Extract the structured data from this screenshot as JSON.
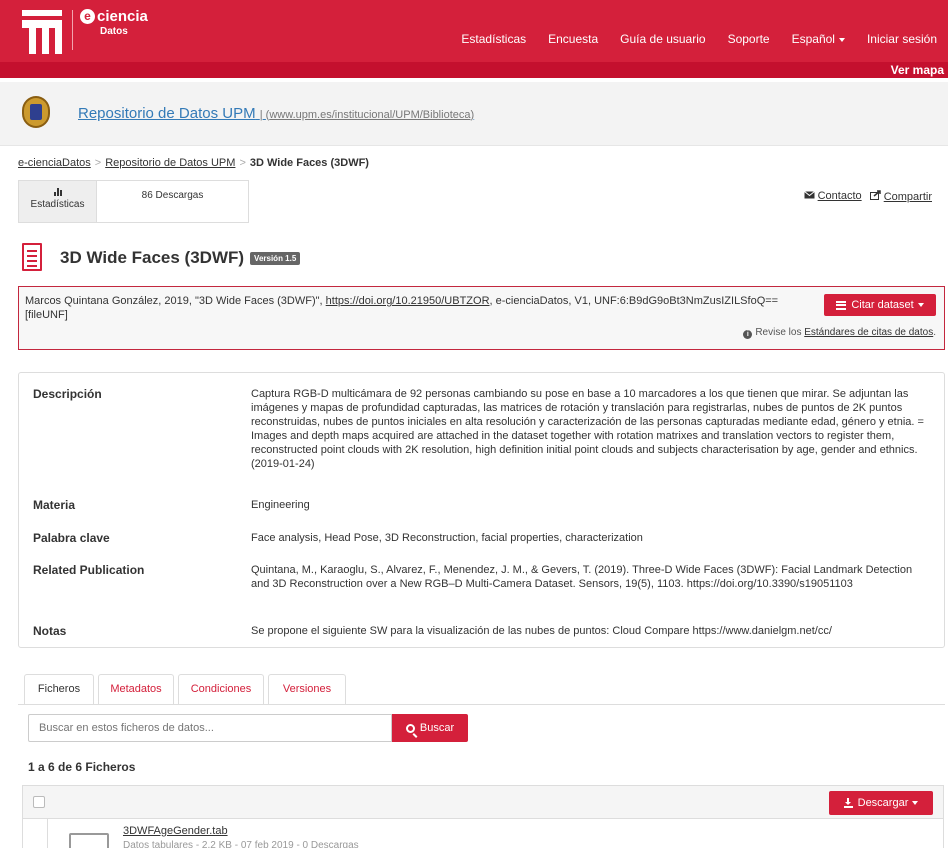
{
  "navbar": {
    "brand_name": "ciencia",
    "brand_e": "e",
    "brand_sub": "Datos",
    "links": [
      "Estadísticas",
      "Encuesta",
      "Guía de usuario",
      "Soporte"
    ],
    "language": "Español",
    "login": "Iniciar sesión",
    "ver_mapa": "Ver mapa"
  },
  "dataverse": {
    "title": "Repositorio de Datos UPM",
    "separator": "|",
    "url_open": "(",
    "url": "www.upm.es/institucional/UPM/Biblioteca",
    "url_close": ")"
  },
  "breadcrumb": {
    "items": [
      "e-cienciaDatos",
      "Repositorio de Datos UPM"
    ],
    "sep": ">",
    "current": "3D Wide Faces (3DWF)"
  },
  "metrics": {
    "button_label": "Estadísticas",
    "downloads": "86 Descargas"
  },
  "actions": {
    "contact": "Contacto",
    "share": "Compartir"
  },
  "dataset": {
    "title": "3D Wide Faces (3DWF)",
    "version": "Versión 1.5"
  },
  "citation": {
    "text_before": "Marcos Quintana González, 2019, \"3D Wide Faces (3DWF)\", ",
    "doi": "https://doi.org/10.21950/UBTZOR",
    "text_after": ", e-cienciaDatos, V1, UNF:6:B9dG9oBt3NmZusIZILSfoQ== [fileUNF]",
    "button": "Citar dataset",
    "revise_prefix": "Revise los ",
    "revise_link": "Estándares de citas de datos",
    "revise_suffix": "."
  },
  "metadata": [
    {
      "label": "Descripción",
      "value": "Captura RGB-D multicámara de 92 personas cambiando su pose en base a 10 marcadores a los que tienen que mirar. Se adjuntan las imágenes y mapas de profundidad capturadas, las matrices de rotación y translación para registrarlas, nubes de puntos de 2K puntos reconstruidas, nubes de puntos iniciales en alta resolución y caracterización de las personas capturadas mediante edad, género y etnia. = Images and depth maps acquired are attached in the dataset together with rotation matrixes and translation vectors to register them, reconstructed point clouds with 2K resolution, high definition initial point clouds and subjects characterisation by age, gender and ethnics. (2019-01-24)"
    },
    {
      "label": "Materia",
      "value": "Engineering"
    },
    {
      "label": "Palabra clave",
      "value": "Face analysis, Head Pose, 3D Reconstruction, facial properties, characterization"
    },
    {
      "label": "Related Publication",
      "value": "Quintana, M., Karaoglu, S., Alvarez, F., Menendez, J. M., & Gevers, T. (2019). Three-D Wide Faces (3DWF): Facial Landmark Detection and 3D Reconstruction over a New RGB–D Multi-Camera Dataset. Sensors, 19(5), 1103. https://doi.org/10.3390/s19051103"
    },
    {
      "label": "Notas",
      "value": "Se propone el siguiente SW para la visualización de las nubes de puntos: Cloud Compare https://www.danielgm.net/cc/"
    }
  ],
  "tabs": [
    "Ficheros",
    "Metadatos",
    "Condiciones",
    "Versiones"
  ],
  "search": {
    "placeholder": "Buscar en estos ficheros de datos...",
    "button": "Buscar"
  },
  "files": {
    "count": "1 a 6 de 6 Ficheros",
    "download_button": "Descargar",
    "rows": [
      {
        "name": "3DWFAgeGender.tab",
        "meta": "Datos tabulares - 2,2 KB - 07 feb 2019 - 0 Descargas"
      }
    ]
  },
  "colors": {
    "brand_red": "#d4203b",
    "link_blue": "#337ab7"
  }
}
